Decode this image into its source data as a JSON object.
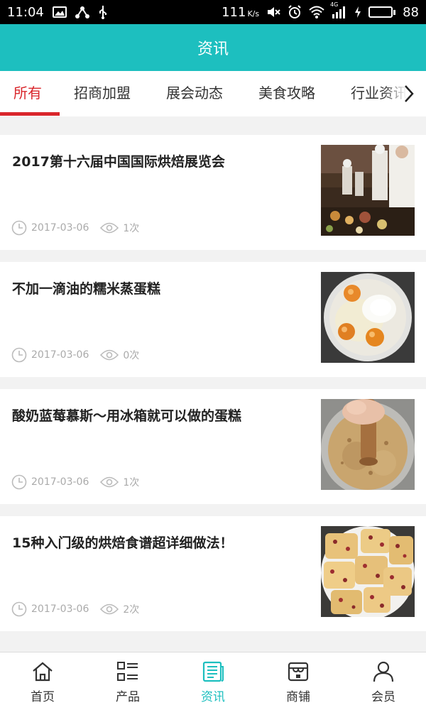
{
  "status_bar": {
    "time": "11:04",
    "net_speed": "111",
    "net_unit": "K/s",
    "network": "4G",
    "battery": "88",
    "battery_level": 0.88
  },
  "header": {
    "title": "资讯"
  },
  "tabs": [
    {
      "label": "所有",
      "active": true
    },
    {
      "label": "招商加盟"
    },
    {
      "label": "展会动态"
    },
    {
      "label": "美食攻略"
    },
    {
      "label": "行业资讯"
    }
  ],
  "articles": [
    {
      "title": "2017第十六届中国国际烘焙展览会",
      "date": "2017-03-06",
      "views": "1次",
      "image": "chefs-buffet"
    },
    {
      "title": "不加一滴油的糯米蒸蛋糕",
      "date": "2017-03-06",
      "views": "0次",
      "image": "eggs-sugar-bowl"
    },
    {
      "title": "酸奶蓝莓慕斯～用冰箱就可以做的蛋糕",
      "date": "2017-03-06",
      "views": "1次",
      "image": "crumbs-pestle"
    },
    {
      "title": "15种入门级的烘焙食谱超详细做法！",
      "date": "2017-03-06",
      "views": "2次",
      "image": "cranberry-cookies"
    }
  ],
  "bottom_nav": [
    {
      "label": "首页",
      "icon": "home-icon"
    },
    {
      "label": "产品",
      "icon": "grid-list-icon"
    },
    {
      "label": "资讯",
      "icon": "news-icon",
      "active": true
    },
    {
      "label": "商铺",
      "icon": "store-icon"
    },
    {
      "label": "会员",
      "icon": "user-icon"
    }
  ],
  "colors": {
    "accent": "#1dbfbf",
    "active_tab": "#d9262b"
  }
}
